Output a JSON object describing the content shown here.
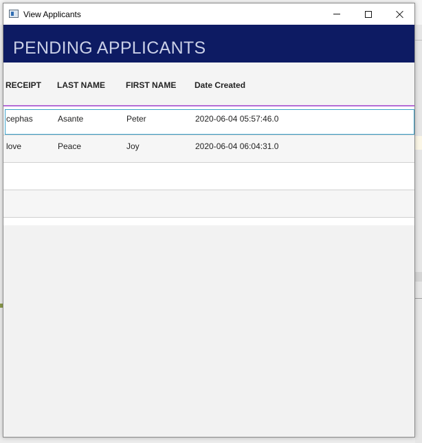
{
  "window": {
    "title": "View Applicants"
  },
  "banner": {
    "title": "PENDING APPLICANTS",
    "background_color": "#0d1b63",
    "text_color": "#c9cfe6"
  },
  "table": {
    "columns": [
      "RECEIPT",
      "LAST NAME",
      "FIRST NAME",
      "Date Created"
    ],
    "rows": [
      {
        "receipt": "cephas",
        "last_name": "Asante",
        "first_name": "Peter",
        "date_created": "2020-06-04 05:57:46.0",
        "selected": true
      },
      {
        "receipt": "love",
        "last_name": "Peace",
        "first_name": "Joy",
        "date_created": "2020-06-04 06:04:31.0",
        "selected": false
      }
    ],
    "empty_rows": 5,
    "selection_color": "#3aa0c8",
    "header_border_color": "#b36bd6"
  }
}
